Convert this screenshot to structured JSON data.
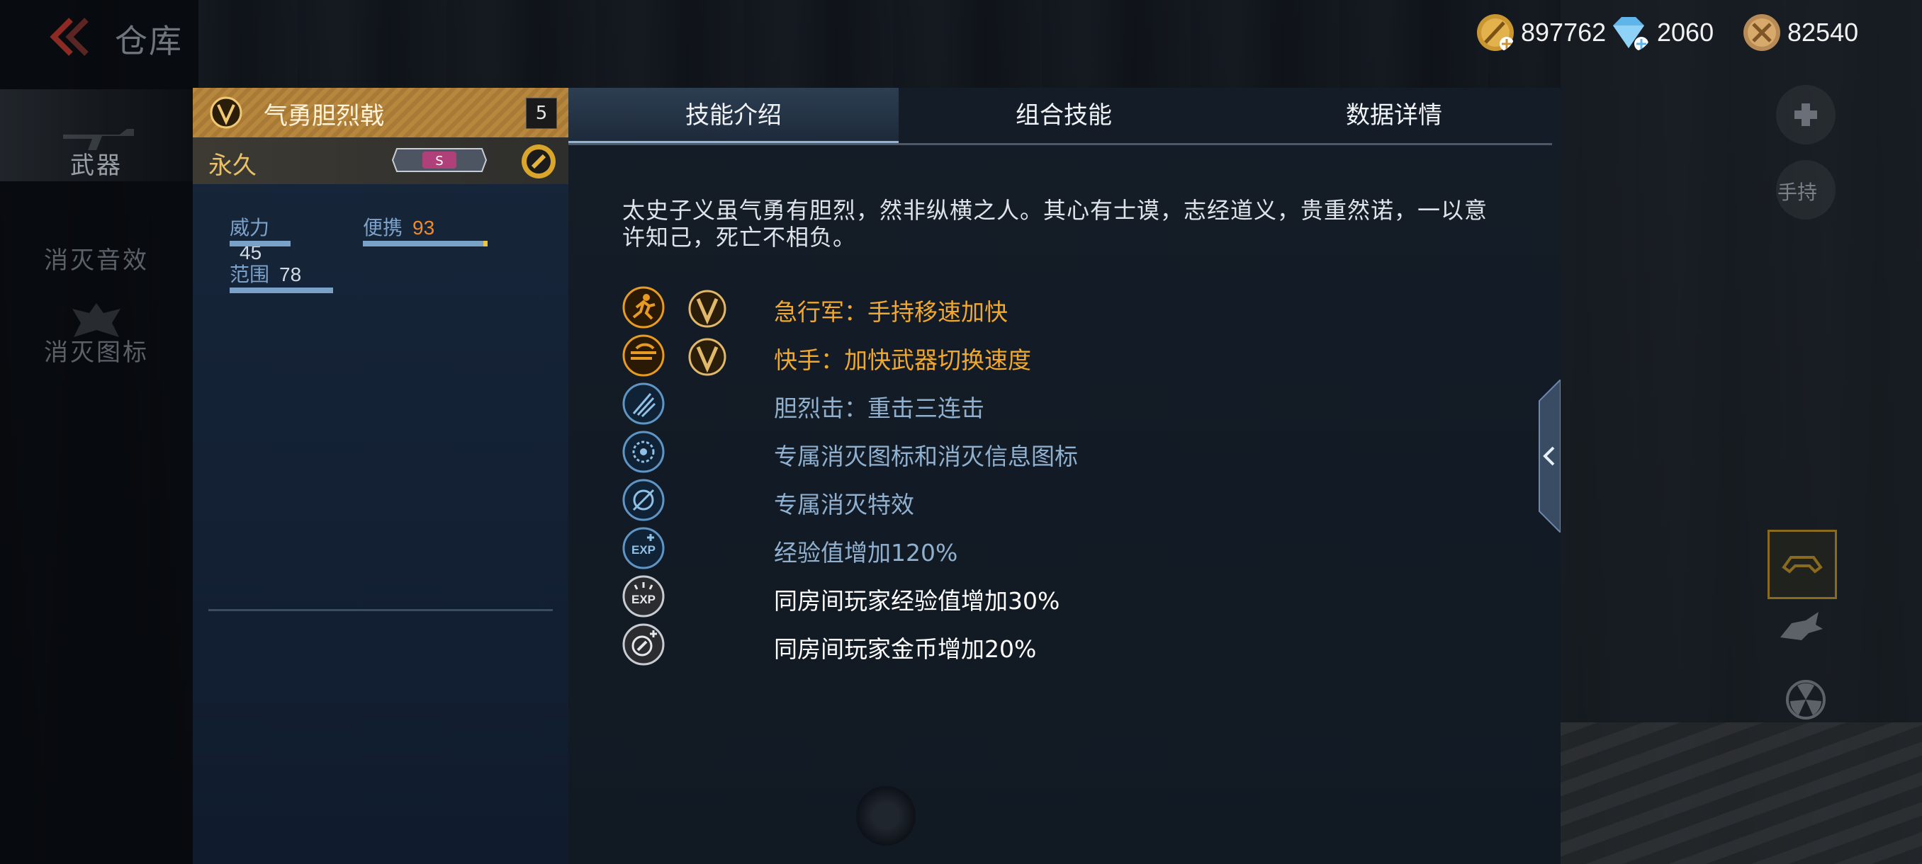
{
  "header": {
    "title": "仓库",
    "currencies": [
      {
        "name": "gold",
        "icon": "gold-coin-icon",
        "value": "897762"
      },
      {
        "name": "diamond",
        "icon": "diamond-icon",
        "value": "2060"
      },
      {
        "name": "medal",
        "icon": "medal-coin-icon",
        "value": "82540"
      }
    ]
  },
  "sidebar": {
    "items": [
      {
        "label": "武器",
        "active": true
      },
      {
        "label": "消灭音效",
        "active": false
      },
      {
        "label": "消灭图标",
        "active": false
      }
    ]
  },
  "weapon": {
    "name": "气勇胆烈戟",
    "level": "5",
    "duration": "永久",
    "rank_badge_text": "S",
    "stats": [
      {
        "label": "威力",
        "value": "45",
        "fraction": 0.45
      },
      {
        "label": "便携",
        "value": "93",
        "fraction": 0.93
      },
      {
        "label": "范围",
        "value": "78",
        "fraction": 0.78
      }
    ]
  },
  "tabs": [
    {
      "label": "技能介绍",
      "active": true
    },
    {
      "label": "组合技能",
      "active": false
    },
    {
      "label": "数据详情",
      "active": false
    }
  ],
  "description": "太史子义虽气勇有胆烈，然非纵横之人。其心有士谟，志经道义，贵重然诺，一以意许知己，死亡不相负。",
  "skills": [
    {
      "icon": "sprint-icon",
      "has_v_badge": true,
      "text": "急行军：手持移速加快",
      "color": "#f0a830"
    },
    {
      "icon": "quick-hand-icon",
      "has_v_badge": true,
      "text": "快手：加快武器切换速度",
      "color": "#f0a830"
    },
    {
      "icon": "triple-strike-icon",
      "has_v_badge": false,
      "text": "胆烈击：重击三连击",
      "color": "#8fb0cf"
    },
    {
      "icon": "kill-icon-badge",
      "has_v_badge": false,
      "text": "专属消灭图标和消灭信息图标",
      "color": "#8fb0cf"
    },
    {
      "icon": "kill-effect-icon",
      "has_v_badge": false,
      "text": "专属消灭特效",
      "color": "#8fb0cf"
    },
    {
      "icon": "exp-boost-icon",
      "has_v_badge": false,
      "text": "经验值增加120%",
      "color": "#8fb0cf"
    },
    {
      "icon": "room-exp-icon",
      "has_v_badge": false,
      "text": "同房间玩家经验值增加30%",
      "color": "#ffffff"
    },
    {
      "icon": "room-coin-icon",
      "has_v_badge": false,
      "text": "同房间玩家金币增加20%",
      "color": "#ffffff"
    }
  ],
  "right_panel": {
    "hold_label": "手持"
  },
  "colors": {
    "accent_gold": "#f0a830",
    "skill_blue": "#8fb0cf",
    "panel_bg": "#141c27"
  }
}
